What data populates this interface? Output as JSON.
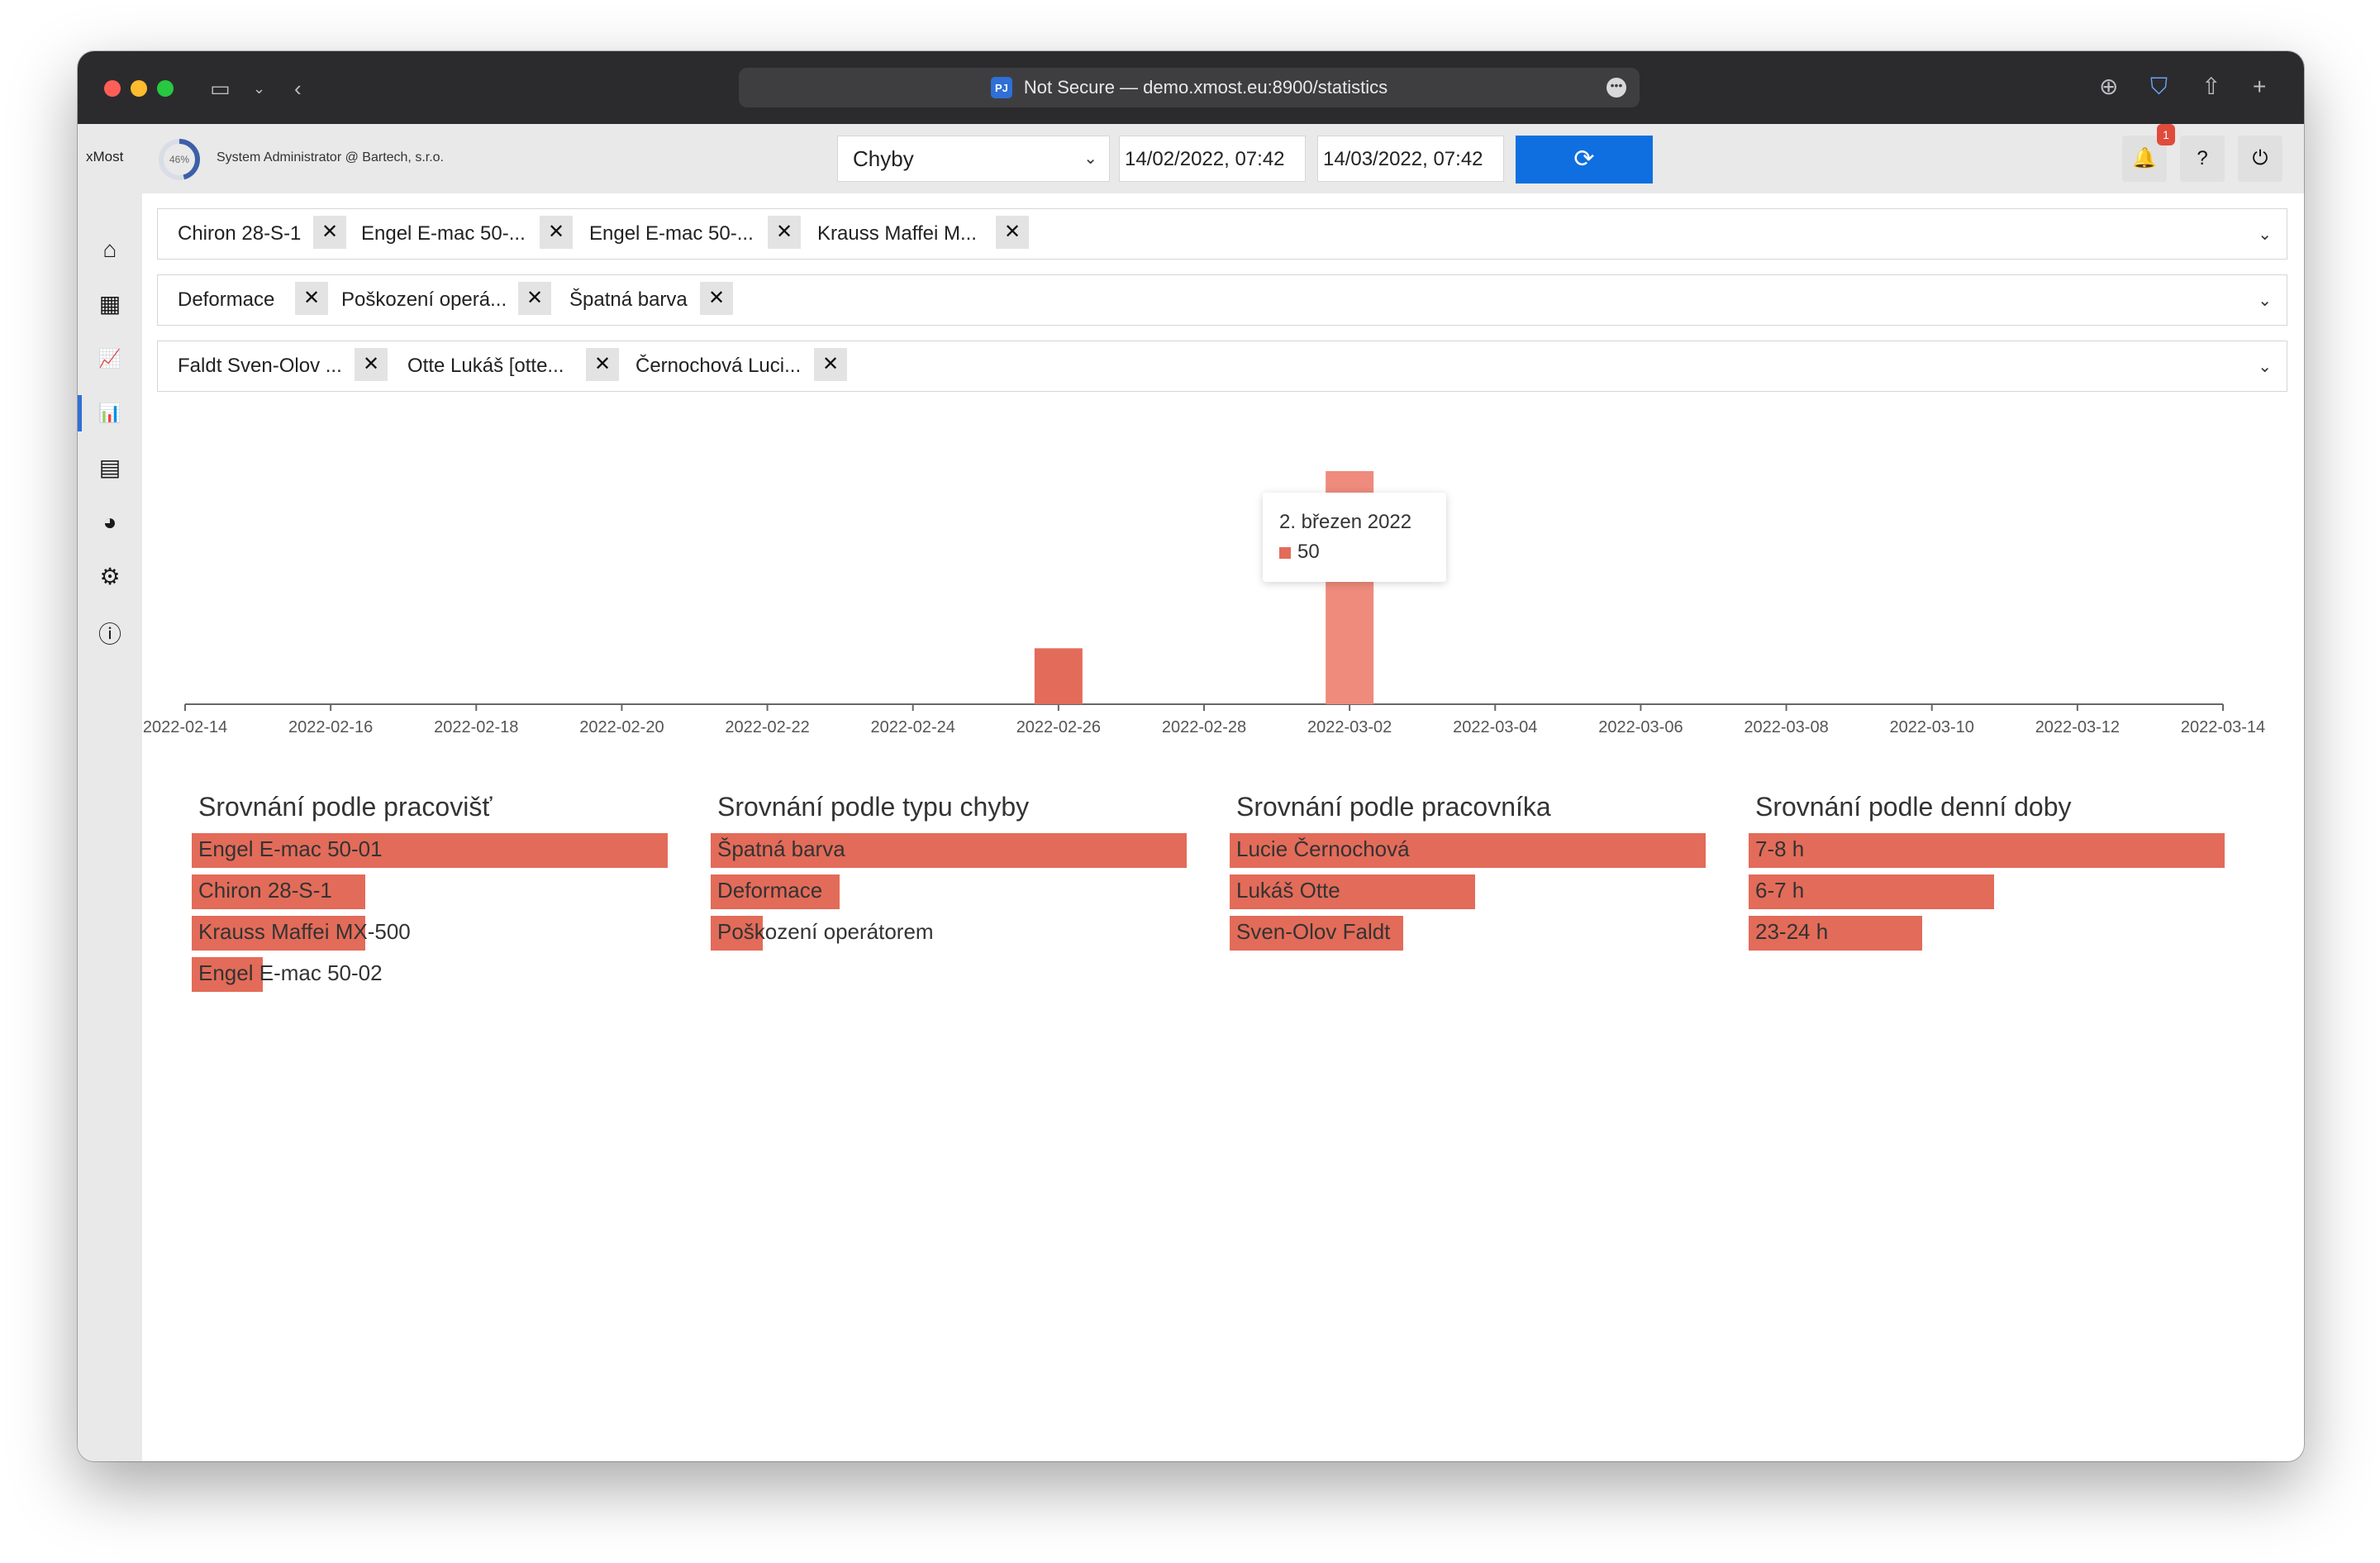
{
  "browser": {
    "url": "Not Secure — demo.xmost.eu:8900/statistics",
    "url_badge": "PJ"
  },
  "app": {
    "logo": "xMost",
    "progress_label": "46%",
    "progress": 0.46,
    "user": "System Administrator @ Bartech, s.r.o.",
    "metric_select": "Chyby",
    "date_from": "14/02/2022, 07:42",
    "date_to": "14/03/2022, 07:42",
    "notification_count": "1"
  },
  "icons": {
    "refresh": "refresh-icon",
    "bell": "bell-icon",
    "help": "help-icon",
    "power": "power-icon"
  },
  "sidebar": {
    "items": [
      {
        "name": "home-icon",
        "glyph": "⌂"
      },
      {
        "name": "dashboard-icon",
        "glyph": "▦"
      },
      {
        "name": "line-chart-icon",
        "glyph": "📈"
      },
      {
        "name": "bar-chart-icon",
        "glyph": "📊"
      },
      {
        "name": "table-icon",
        "glyph": "▤"
      },
      {
        "name": "pie-chart-icon",
        "glyph": "◕"
      },
      {
        "name": "settings-icon",
        "glyph": "⚙"
      },
      {
        "name": "info-icon",
        "glyph": "ⓘ"
      }
    ],
    "active_index": 3
  },
  "filters": {
    "workplaces": [
      "Chiron 28-S-1",
      "Engel E-mac 50-...",
      "Engel E-mac 50-...",
      "Krauss Maffei M..."
    ],
    "error_types": [
      "Deformace",
      "Poškození operá...",
      "Špatná barva"
    ],
    "workers": [
      "Faldt Sven-Olov ...",
      "Otte Lukáš [otte...",
      "Černochová Luci..."
    ]
  },
  "chart_data": {
    "type": "bar",
    "x_ticks": [
      "2022-02-14",
      "2022-02-16",
      "2022-02-18",
      "2022-02-20",
      "2022-02-22",
      "2022-02-24",
      "2022-02-26",
      "2022-02-28",
      "2022-03-02",
      "2022-03-04",
      "2022-03-06",
      "2022-03-08",
      "2022-03-10",
      "2022-03-12",
      "2022-03-14"
    ],
    "points": [
      {
        "date": "2022-02-26",
        "value": 12
      },
      {
        "date": "2022-03-02",
        "value": 50
      }
    ],
    "ylim": [
      0,
      50
    ],
    "grid": false,
    "tooltip": {
      "title": "2. březen 2022",
      "value": "50"
    },
    "bar_color": "#e36b59",
    "highlight_color": "#ee8b7c"
  },
  "comparisons": [
    {
      "title": "Srovnání podle pracovišť",
      "rows": [
        {
          "label": "Engel E-mac 50-01",
          "value": 1.0
        },
        {
          "label": "Chiron 28-S-1",
          "value": 0.365
        },
        {
          "label": "Krauss Maffei MX-500",
          "value": 0.365
        },
        {
          "label": "Engel E-mac 50-02",
          "value": 0.15
        }
      ]
    },
    {
      "title": "Srovnání podle typu chyby",
      "rows": [
        {
          "label": "Špatná barva",
          "value": 1.0
        },
        {
          "label": "Deformace",
          "value": 0.27
        },
        {
          "label": "Poškození operátorem",
          "value": 0.11
        }
      ]
    },
    {
      "title": "Srovnání podle pracovníka",
      "rows": [
        {
          "label": "Lucie Černochová",
          "value": 1.0
        },
        {
          "label": "Lukáš Otte",
          "value": 0.515
        },
        {
          "label": "Sven-Olov Faldt",
          "value": 0.365
        }
      ]
    },
    {
      "title": "Srovnání podle denní doby",
      "rows": [
        {
          "label": "7-8 h",
          "value": 1.0
        },
        {
          "label": "6-7 h",
          "value": 0.515
        },
        {
          "label": "23-24 h",
          "value": 0.365
        }
      ]
    }
  ]
}
